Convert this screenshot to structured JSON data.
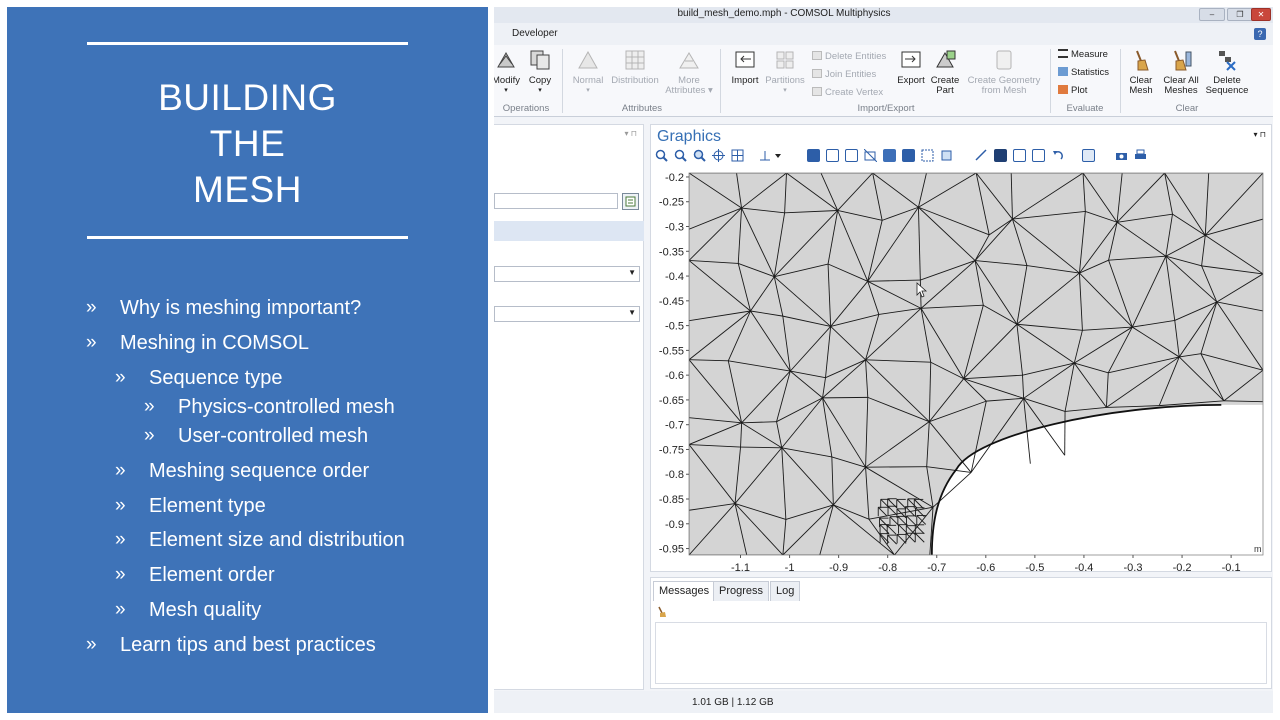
{
  "slide": {
    "title_lines": [
      "BUILDING",
      "THE",
      "MESH"
    ],
    "bullets": [
      {
        "text": "Why is meshing important?",
        "level": 1
      },
      {
        "text": "Meshing in COMSOL",
        "level": 1
      },
      {
        "text": "Sequence type",
        "level": 2
      },
      {
        "text": "Physics-controlled mesh",
        "level": 3
      },
      {
        "text": "User-controlled mesh",
        "level": 3
      },
      {
        "text": "Meshing sequence order",
        "level": 2
      },
      {
        "text": "Element type",
        "level": 2
      },
      {
        "text": "Element size and distribution",
        "level": 2
      },
      {
        "text": "Element order",
        "level": 2
      },
      {
        "text": "Mesh quality",
        "level": 2
      },
      {
        "text": "Learn tips and best practices",
        "level": 1
      }
    ],
    "bullet_glyph": "»"
  },
  "window": {
    "title": "build_mesh_demo.mph - COMSOL Multiphysics",
    "ribbon_tab": "Developer",
    "help": "?",
    "min": "–",
    "max": "❐",
    "close": "✕"
  },
  "ribbon": {
    "modify": "Modify",
    "copy": "Copy",
    "normal": "Normal",
    "distribution": "Distribution",
    "more_attributes": [
      "More",
      "Attributes ▾"
    ],
    "import": "Import",
    "partitions": "Partitions",
    "delete_entities": "Delete Entities",
    "join_entities": "Join Entities",
    "create_vertex": "Create Vertex",
    "export": "Export",
    "create_part": [
      "Create",
      "Part"
    ],
    "create_geometry": [
      "Create Geometry",
      "from Mesh"
    ],
    "measure": "Measure",
    "statistics": "Statistics",
    "plot": "Plot",
    "clear_mesh": [
      "Clear",
      "Mesh"
    ],
    "clear_all_meshes": [
      "Clear All",
      "Meshes"
    ],
    "delete_sequence": [
      "Delete",
      "Sequence"
    ],
    "groups": {
      "operations": "Operations",
      "attributes": "Attributes",
      "import_export": "Import/Export",
      "evaluate": "Evaluate",
      "clear": "Clear"
    }
  },
  "graphics": {
    "title": "Graphics",
    "unit": "m",
    "y_ticks": [
      "-0.2",
      "-0.25",
      "-0.3",
      "-0.35",
      "-0.4",
      "-0.45",
      "-0.5",
      "-0.55",
      "-0.6",
      "-0.65",
      "-0.7",
      "-0.75",
      "-0.8",
      "-0.85",
      "-0.9",
      "-0.95"
    ],
    "x_ticks": [
      "-1.1",
      "-1",
      "-0.9",
      "-0.8",
      "-0.7",
      "-0.6",
      "-0.5",
      "-0.4",
      "-0.3",
      "-0.2",
      "-0.1"
    ],
    "colors": {
      "mesh_fill": "#d4d4d4",
      "edge": "#1a1a1a",
      "accent": "#3670b5"
    }
  },
  "messages": {
    "tabs": [
      "Messages",
      "Progress",
      "Log"
    ]
  },
  "status": {
    "memory": "1.01 GB | 1.12 GB"
  }
}
